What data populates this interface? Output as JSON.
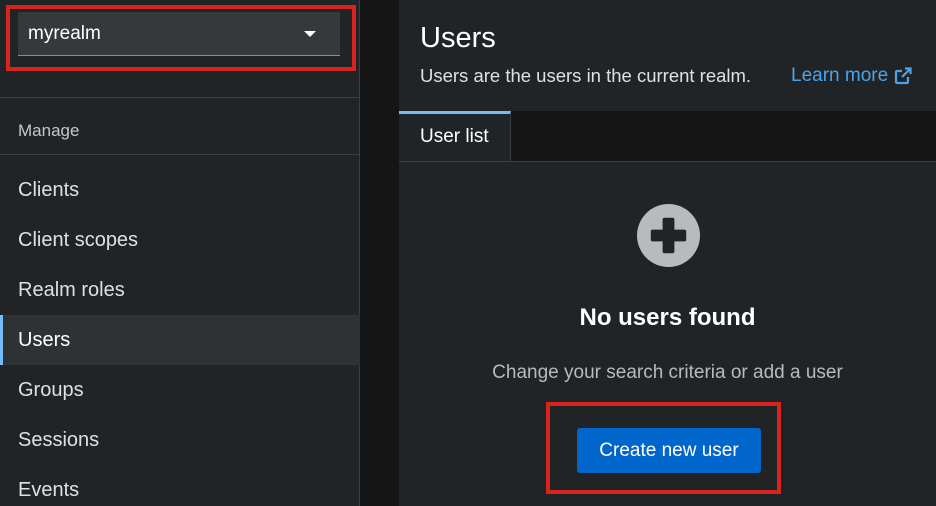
{
  "sidebar": {
    "realm_selector": {
      "value": "myrealm"
    },
    "section_title": "Manage",
    "items": [
      {
        "label": "Clients"
      },
      {
        "label": "Client scopes"
      },
      {
        "label": "Realm roles"
      },
      {
        "label": "Users",
        "active": true
      },
      {
        "label": "Groups"
      },
      {
        "label": "Sessions"
      },
      {
        "label": "Events"
      }
    ]
  },
  "header": {
    "title": "Users",
    "subtitle": "Users are the users in the current realm.",
    "learn_more": "Learn more",
    "learn_more_icon": "external-link-icon"
  },
  "tabs": [
    {
      "label": "User list",
      "active": true
    }
  ],
  "empty_state": {
    "icon": "plus-circle-icon",
    "title": "No users found",
    "body": "Change your search criteria or add a user",
    "button_label": "Create new user"
  },
  "colors": {
    "accent_blue": "#0066cc",
    "link_blue": "#4ba3e8",
    "active_indicator": "#73bcf7",
    "highlight_red": "#d9231d",
    "sidebar_bg": "#212427",
    "page_bg": "#151515"
  }
}
